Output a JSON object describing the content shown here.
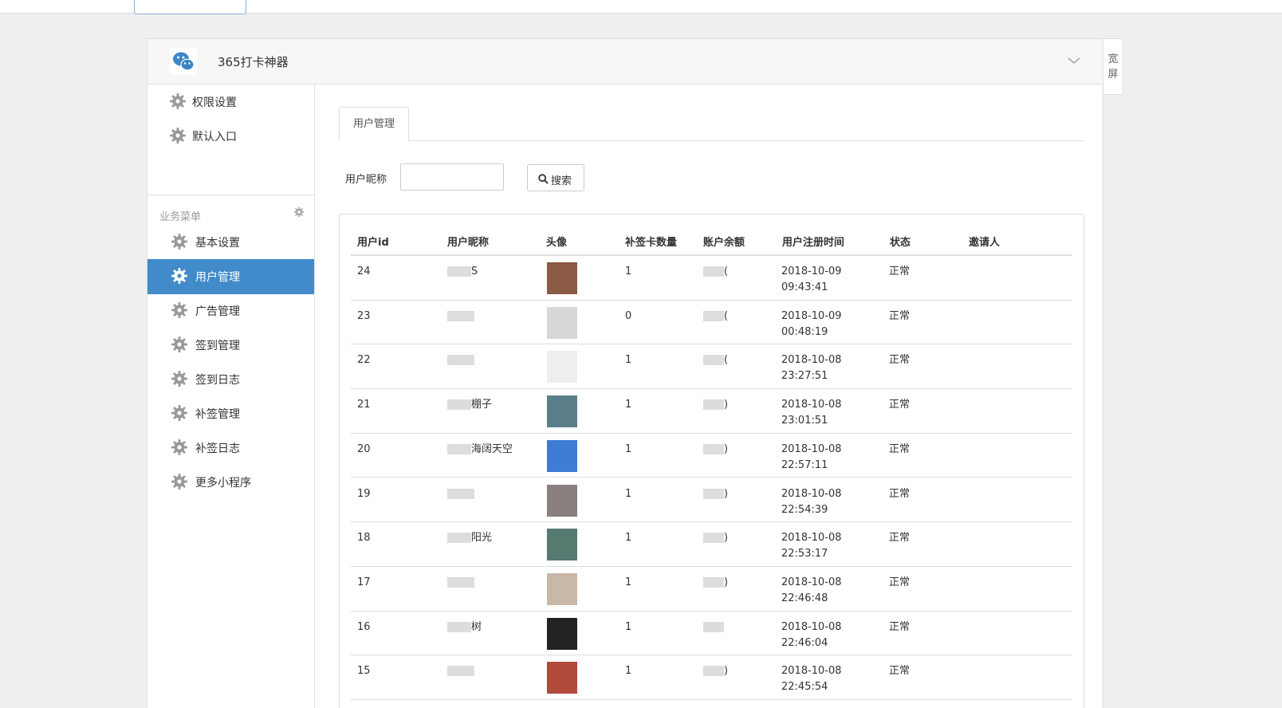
{
  "top_tab": {
    "title": "",
    "subtitle": ""
  },
  "header": {
    "app_name": "365打卡神器"
  },
  "wide_toggle": {
    "line1": "宽",
    "line2": "屏"
  },
  "sidebar": {
    "top_items": [
      {
        "label": "权限设置"
      },
      {
        "label": "默认入口"
      }
    ],
    "section_title": "业务菜单",
    "items": [
      {
        "label": "基本设置",
        "active": false
      },
      {
        "label": "用户管理",
        "active": true
      },
      {
        "label": "广告管理",
        "active": false
      },
      {
        "label": "签到管理",
        "active": false
      },
      {
        "label": "签到日志",
        "active": false
      },
      {
        "label": "补签管理",
        "active": false
      },
      {
        "label": "补签日志",
        "active": false
      },
      {
        "label": "更多小程序",
        "active": false
      }
    ]
  },
  "main": {
    "tab_label": "用户管理",
    "search": {
      "label": "用户昵称",
      "value": "",
      "placeholder": "",
      "button_label": "搜索"
    }
  },
  "table": {
    "columns": [
      "用户id",
      "用户昵称",
      "头像",
      "补签卡数量",
      "账户余额",
      "用户注册时间",
      "状态",
      "邀请人"
    ],
    "rows": [
      {
        "id": "24",
        "nickname": "S",
        "avatar_color": "#8a5a44",
        "cards": "1",
        "balance": "(",
        "date": "2018-10-09",
        "time": "09:43:41",
        "status": "正常",
        "inviter": ""
      },
      {
        "id": "23",
        "nickname": "",
        "avatar_color": "#d8d8d8",
        "cards": "0",
        "balance": "(",
        "date": "2018-10-09",
        "time": "00:48:19",
        "status": "正常",
        "inviter": ""
      },
      {
        "id": "22",
        "nickname": "",
        "avatar_color": "#eeeeee",
        "cards": "1",
        "balance": "(",
        "date": "2018-10-08",
        "time": "23:27:51",
        "status": "正常",
        "inviter": ""
      },
      {
        "id": "21",
        "nickname": "棚子",
        "avatar_color": "#5b7f8a",
        "cards": "1",
        "balance": ")",
        "date": "2018-10-08",
        "time": "23:01:51",
        "status": "正常",
        "inviter": ""
      },
      {
        "id": "20",
        "nickname": "海阔天空",
        "avatar_color": "#3d7dd6",
        "cards": "1",
        "balance": ")",
        "date": "2018-10-08",
        "time": "22:57:11",
        "status": "正常",
        "inviter": ""
      },
      {
        "id": "19",
        "nickname": "",
        "avatar_color": "#8a8080",
        "cards": "1",
        "balance": ")",
        "date": "2018-10-08",
        "time": "22:54:39",
        "status": "正常",
        "inviter": ""
      },
      {
        "id": "18",
        "nickname": "阳光",
        "avatar_color": "#557a70",
        "cards": "1",
        "balance": ")",
        "date": "2018-10-08",
        "time": "22:53:17",
        "status": "正常",
        "inviter": ""
      },
      {
        "id": "17",
        "nickname": "",
        "avatar_color": "#c9b8a8",
        "cards": "1",
        "balance": ")",
        "date": "2018-10-08",
        "time": "22:46:48",
        "status": "正常",
        "inviter": ""
      },
      {
        "id": "16",
        "nickname": "树",
        "avatar_color": "#222222",
        "cards": "1",
        "balance": "",
        "date": "2018-10-08",
        "time": "22:46:04",
        "status": "正常",
        "inviter": ""
      },
      {
        "id": "15",
        "nickname": "",
        "avatar_color": "#b04a3a",
        "cards": "1",
        "balance": ")",
        "date": "2018-10-08",
        "time": "22:45:54",
        "status": "正常",
        "inviter": ""
      }
    ]
  },
  "colors": {
    "accent": "#428bca",
    "border": "#dddddd",
    "background": "#efefef",
    "gear": "#999999"
  }
}
